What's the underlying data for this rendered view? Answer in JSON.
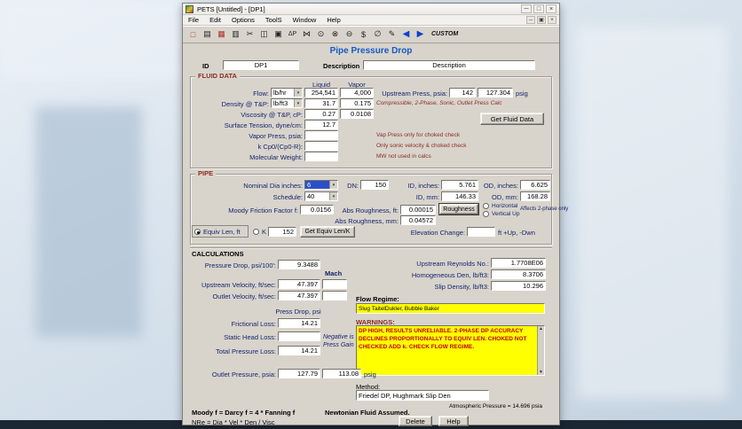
{
  "colors": {
    "accent_blue": "#1659c4",
    "maroon": "#8c2b21",
    "warning_red": "#c00000",
    "highlight_yellow": "#ffff00",
    "selection_blue": "#2a50c8",
    "window_gray": "#d8d4cc"
  },
  "window": {
    "title": "PETS [Untitled] - [DP1]",
    "controls": {
      "minimize": "─",
      "maximize": "□",
      "close": "×",
      "mdi_minimize": "─",
      "mdi_restore": "▣",
      "mdi_close": "×"
    },
    "menus": [
      "File",
      "Edit",
      "Options",
      "ToolS",
      "Window",
      "Help"
    ],
    "toolbar_icons": [
      {
        "name": "new",
        "glyph": "□"
      },
      {
        "name": "open",
        "glyph": "▤"
      },
      {
        "name": "save",
        "glyph": "▦"
      },
      {
        "name": "print",
        "glyph": "▥"
      },
      {
        "name": "cut",
        "glyph": "✂"
      },
      {
        "name": "copy",
        "glyph": "◫"
      },
      {
        "name": "paste",
        "glyph": "▣"
      },
      {
        "name": "delta-p",
        "glyph": "ΔP"
      },
      {
        "name": "fittings",
        "glyph": "⋈"
      },
      {
        "name": "pump",
        "glyph": "⊙"
      },
      {
        "name": "valve",
        "glyph": "⊗"
      },
      {
        "name": "orifice",
        "glyph": "⊖"
      },
      {
        "name": "cost",
        "glyph": "$"
      },
      {
        "name": "slope",
        "glyph": "∅"
      },
      {
        "name": "edit",
        "glyph": "✎"
      },
      {
        "name": "nav-back",
        "glyph": "◀"
      },
      {
        "name": "nav-forward",
        "glyph": "▶"
      }
    ],
    "custom_label": "CUSTOM"
  },
  "form": {
    "title": "Pipe Pressure Drop",
    "id_label": "ID",
    "id_value": "DP1",
    "description_label": "Description",
    "description_value": "Description"
  },
  "fluid_data": {
    "section_label": "FLUID DATA",
    "col_liquid": "Liquid",
    "col_vapor": "Vapor",
    "flow_label": "Flow:",
    "flow_unit": "lb/hr",
    "flow_liquid": "254,541",
    "flow_vapor": "4,000",
    "upstream_press_label": "Upstream Press, psia:",
    "upstream_press_psia": "142",
    "upstream_press_psig": "127.304",
    "psig_label": "psig",
    "density_label": "Density @ T&P:",
    "density_unit": "lb/ft3",
    "density_liquid": "31.7",
    "density_vapor": "0.175",
    "compressible_note": "Compressible, 2-Phase, Sonic, Outlet Press Calc",
    "viscosity_label": "Viscosity @ T&P, cP:",
    "viscosity_liquid": "0.27",
    "viscosity_vapor": "0.0108",
    "surface_tension_label": "Surface Tension, dyne/cm:",
    "surface_tension_value": "12.7",
    "get_fluid_data_button": "Get Fluid Data",
    "vapor_press_label": "Vapor Press, psia:",
    "vapor_press_value": "",
    "vap_press_note": "Vap Press only for choked check",
    "k_label": "k Cp0/(Cp0-R):",
    "k_value": "",
    "k_note": "Only sonic velocity & choked check",
    "mw_label": "Molecular Weight:",
    "mw_value": "",
    "mw_note": "MW not used in calcs"
  },
  "pipe": {
    "section_label": "PIPE",
    "nominal_dia_label": "Nominal Dia inches:",
    "nominal_dia_value": "6",
    "dn_label": "DN:",
    "dn_value": "150",
    "id_inches_label": "ID, inches:",
    "id_inches_value": "5.761",
    "od_inches_label": "OD, inches:",
    "od_inches_value": "6.625",
    "schedule_label": "Schedule:",
    "schedule_value": "40",
    "id_mm_label": "ID, mm:",
    "id_mm_value": "146.33",
    "od_mm_label": "OD, mm:",
    "od_mm_value": "168.28",
    "moody_label": "Moody Friction Factor f:",
    "moody_value": "0.0156",
    "abs_rough_ft_label": "Abs Roughness, ft:",
    "abs_rough_ft_value": "0.00015",
    "roughness_button": "Roughness",
    "horizontal_label": "Horizontal",
    "vertical_label": "Vertical Up",
    "affects_note": "Affects 2-phase only",
    "abs_rough_mm_label": "Abs Roughness, mm:",
    "abs_rough_mm_value": "0.04572",
    "equiv_len_label": "Equiv Len, ft",
    "k_radio_label": "K",
    "equiv_len_value": "152",
    "get_equiv_button": "Get Equiv Len/K",
    "elevation_label": "Elevation Change:",
    "elevation_value": "",
    "elevation_note": "ft +Up, -Dwn"
  },
  "calculations": {
    "section_label": "CALCULATIONS",
    "pressure_drop_label": "Pressure Drop, psi/100':",
    "pressure_drop_value": "9.3488",
    "mach_label": "Mach",
    "upstream_reynolds_label": "Upstream Reynolds No.:",
    "upstream_reynolds_value": "1.7708E06",
    "homogeneous_den_label": "Homogeneous Den, lb/ft3:",
    "homogeneous_den_value": "8.3706",
    "upstream_vel_label": "Upstream Velocity, ft/sec:",
    "upstream_vel_value": "47.397",
    "upstream_mach_value": "",
    "outlet_vel_label": "Outlet Velocity, ft/sec:",
    "outlet_vel_value": "47.397",
    "outlet_mach_value": "",
    "slip_density_label": "Slip Density, lb/ft3:",
    "slip_density_value": "10.296",
    "flow_regime_label": "Flow Regime:",
    "flow_regime_value": "Slug TaitelDukler, Bubble Baker",
    "press_drop_psi_label": "Press Drop, psi",
    "frictional_loss_label": "Frictional Loss:",
    "frictional_loss_value": "14.21",
    "static_head_label": "Static Head Loss:",
    "static_head_value": "",
    "negative_note": "Negative is Press Gain",
    "total_loss_label": "Total Pressure Loss:",
    "total_loss_value": "14.21",
    "warnings_label": "WARNINGS:",
    "warnings_text": "DP HIGH, RESULTS UNRELIABLE. 2-PHASE DP ACCURACY DECLINES PROPORTIONALLY TO EQUIV LEN. CHOKED NOT CHECKED ADD k. CHECK FLOW REGIME.",
    "outlet_press_label": "Outlet Pressure, psia:",
    "outlet_press_psia": "127.79",
    "outlet_press_psig": "113.08",
    "psig_label": "psig",
    "method_label": "Method:",
    "method_value": "Friedel DP, Hughmark Slip Den"
  },
  "footer": {
    "moody_note": "Moody f = Darcy f = 4 * Fanning f",
    "newtonian_note": "Newtonian Fluid Assumed.",
    "nre_note": "NRe = Dia * Vel * Den / Visc",
    "atm_note": "Atmospheric Pressure = 14.696 psia",
    "delete_button": "Delete",
    "help_button": "Help"
  }
}
